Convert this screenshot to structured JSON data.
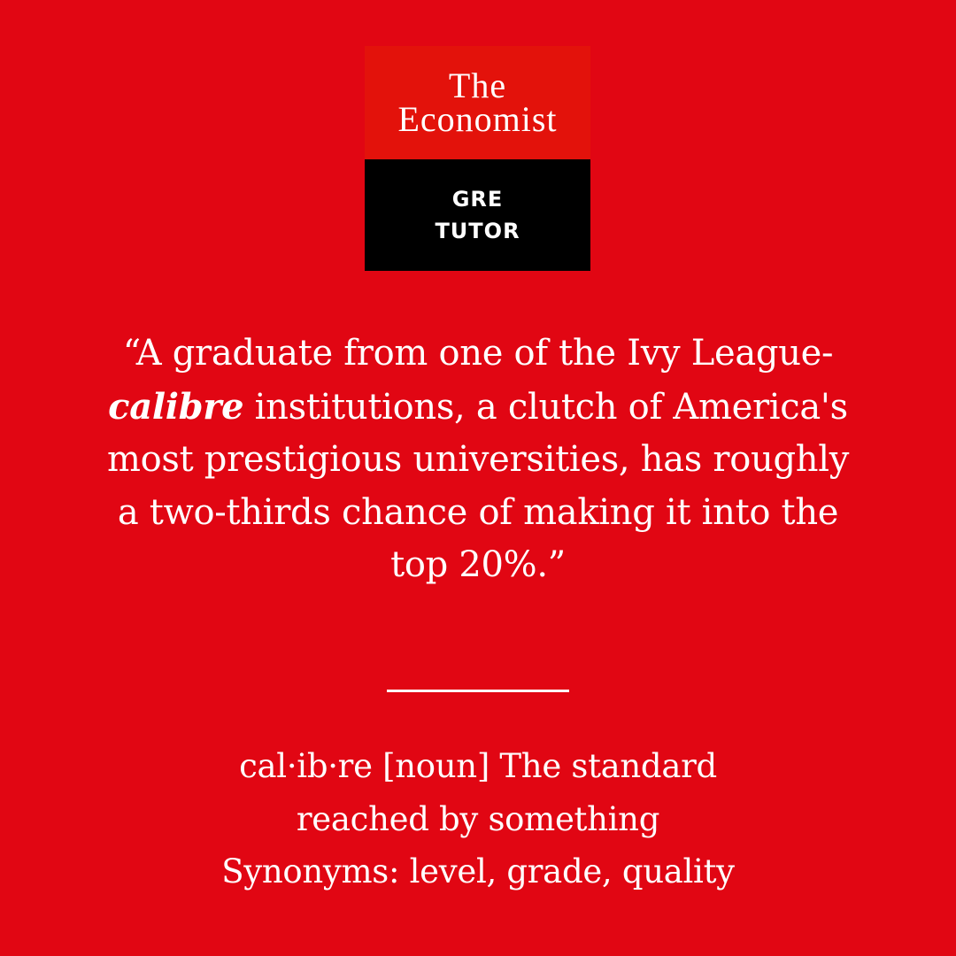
{
  "colors": {
    "background": "#e10613",
    "logo_red": "#e3120b",
    "logo_black": "#000000",
    "text": "#ffffff"
  },
  "logo": {
    "line1": "The",
    "line2": "Economist",
    "product_line1": "GRE",
    "product_line2": "TUTOR"
  },
  "quote": {
    "before": "“A graduate from one of the Ivy League-",
    "word": "calibre",
    "after": " institutions, a clutch of America's most prestigious universities, has roughly a two-thirds chance of making it into the top 20%.”"
  },
  "definition": {
    "line1": "cal·ib·re [noun] The standard",
    "line2": "reached by something",
    "line3": "Synonyms: level, grade, quality"
  }
}
